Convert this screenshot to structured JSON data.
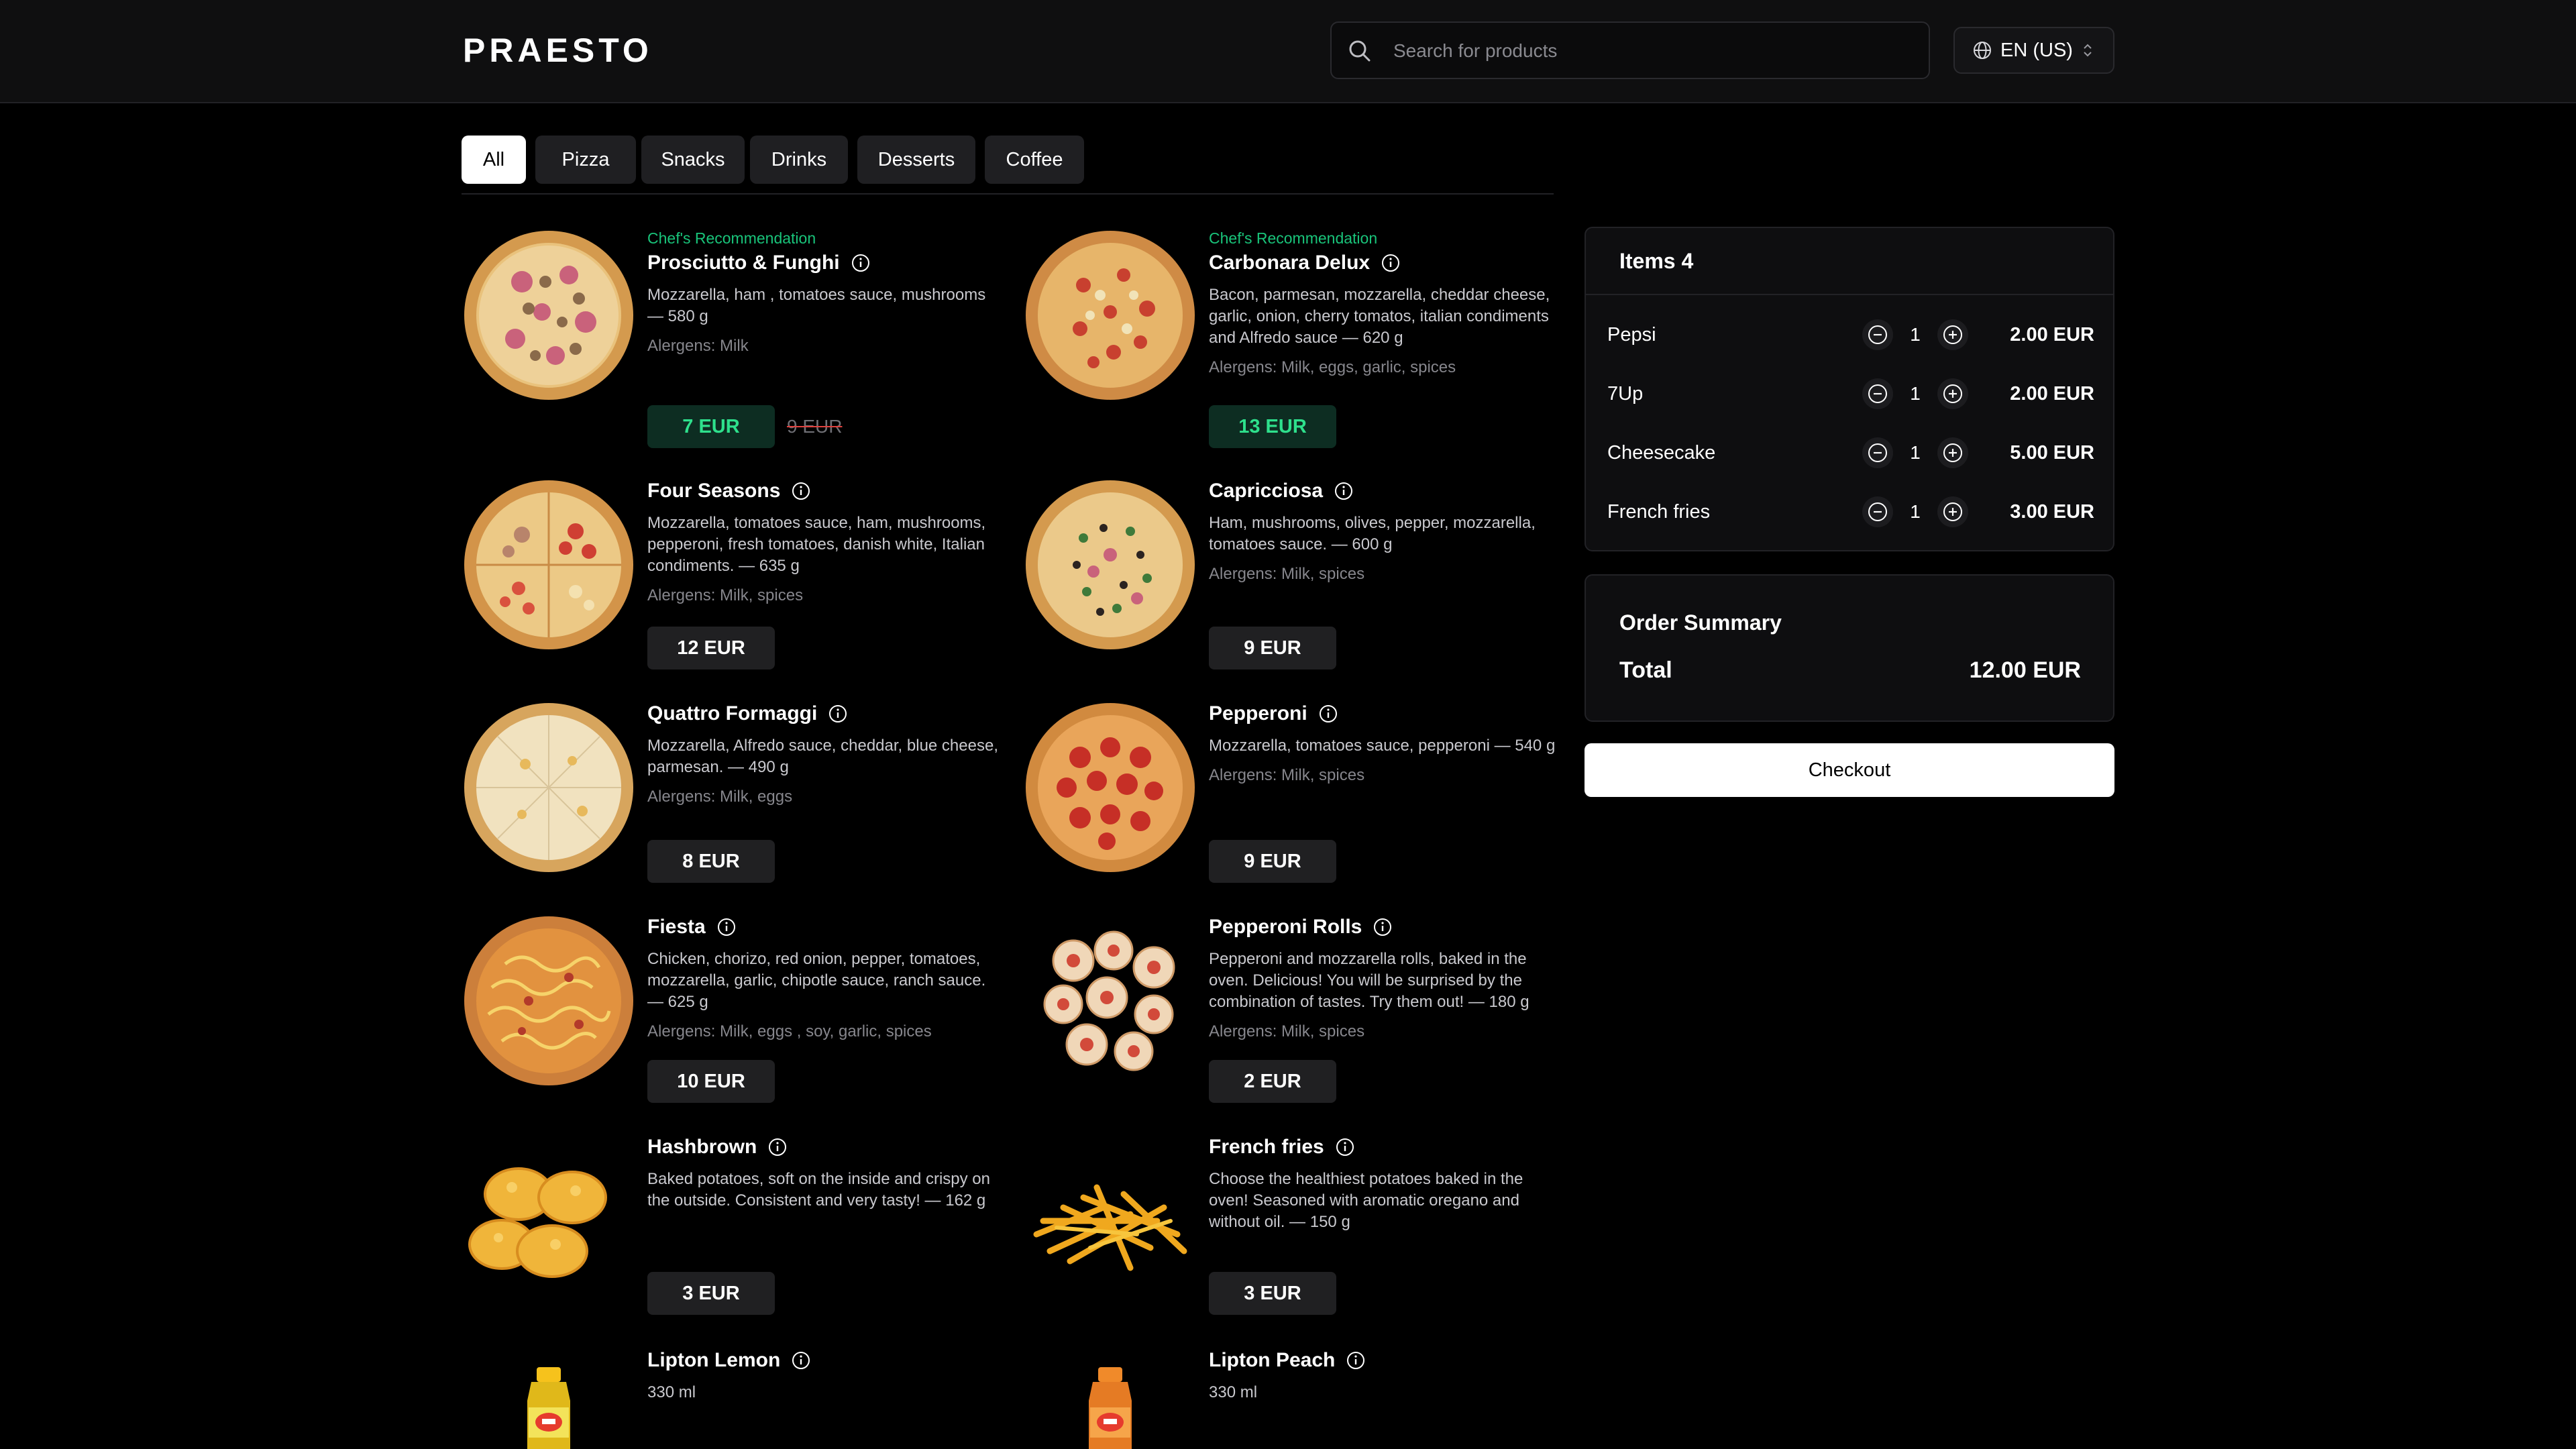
{
  "header": {
    "logo": "PRAESTO",
    "search_placeholder": "Search for products",
    "language": "EN (US)"
  },
  "tabs": [
    "All",
    "Pizza",
    "Snacks",
    "Drinks",
    "Desserts",
    "Coffee"
  ],
  "active_tab": "All",
  "products": [
    {
      "recommendation": "Chef's Recommendation",
      "name": "Prosciutto & Funghi",
      "description": "Mozzarella, ham , tomatoes sauce, mushrooms — 580 g",
      "allergens": "Alergens: Milk",
      "price": "7 EUR",
      "old_price": "9 EUR",
      "image": "pizza-prosciutto"
    },
    {
      "recommendation": "Chef's Recommendation",
      "name": "Carbonara Delux",
      "description": "Bacon, parmesan, mozzarella, cheddar cheese, garlic, onion, cherry tomatos, italian condiments and Alfredo sauce — 620 g",
      "allergens": "Alergens: Milk, eggs, garlic, spices",
      "price": "13 EUR",
      "image": "pizza-carbonara"
    },
    {
      "name": "Four Seasons",
      "description": "Mozzarella, tomatoes sauce, ham, mushrooms, pepperoni, fresh tomatoes, danish white, Italian condiments. — 635 g",
      "allergens": "Alergens: Milk, spices",
      "price": "12 EUR",
      "image": "pizza-four-seasons"
    },
    {
      "name": "Capricciosa",
      "description": "Ham, mushrooms, olives, pepper, mozzarella, tomatoes sauce. — 600 g",
      "allergens": "Alergens: Milk, spices",
      "price": "9 EUR",
      "image": "pizza-capricciosa"
    },
    {
      "name": "Quattro Formaggi",
      "description": "Mozzarella, Alfredo sauce, cheddar, blue cheese, parmesan. — 490 g",
      "allergens": "Alergens: Milk, eggs",
      "price": "8 EUR",
      "image": "pizza-quattro-formaggi"
    },
    {
      "name": "Pepperoni",
      "description": "Mozzarella, tomatoes sauce, pepperoni — 540 g",
      "allergens": "Alergens: Milk, spices",
      "price": "9 EUR",
      "image": "pizza-pepperoni"
    },
    {
      "name": "Fiesta",
      "description": "Chicken, chorizo, red onion, pepper, tomatoes, mozzarella, garlic, chipotle sauce, ranch sauce. — 625 g",
      "allergens": "Alergens: Milk, eggs , soy, garlic, spices",
      "price": "10 EUR",
      "image": "pizza-fiesta"
    },
    {
      "name": "Pepperoni Rolls",
      "description": "Pepperoni and mozzarella rolls, baked in the oven. Delicious! You will be surprised by the combination of tastes. Try them out! — 180 g",
      "allergens": "Alergens: Milk, spices",
      "price": "2 EUR",
      "image": "pepperoni-rolls"
    },
    {
      "name": "Hashbrown",
      "description": "Baked potatoes, soft on the inside and crispy on the outside. Consistent and very tasty! — 162 g",
      "price": "3 EUR",
      "image": "hashbrown"
    },
    {
      "name": "French fries",
      "description": "Choose the healthiest potatoes baked in the oven! Seasoned with aromatic oregano and without oil. — 150 g",
      "price": "3 EUR",
      "image": "french-fries"
    },
    {
      "name": "Lipton Lemon",
      "description": "330 ml",
      "image": "lipton-lemon-bottle"
    },
    {
      "name": "Lipton Peach",
      "description": "330 ml",
      "image": "lipton-peach-bottle"
    }
  ],
  "cart": {
    "title": "Items 4",
    "items": [
      {
        "name": "Pepsi",
        "qty": "1",
        "total": "2.00 EUR"
      },
      {
        "name": "7Up",
        "qty": "1",
        "total": "2.00 EUR"
      },
      {
        "name": "Cheesecake",
        "qty": "1",
        "total": "5.00 EUR"
      },
      {
        "name": "French fries",
        "qty": "1",
        "total": "3.00 EUR"
      }
    ]
  },
  "summary": {
    "title": "Order Summary",
    "total_label": "Total",
    "total_value": "12.00 EUR"
  },
  "checkout_label": "Checkout",
  "colors": {
    "background": "#000000",
    "accent_green": "#2ee08c",
    "recommendation_green": "#19c47a",
    "price_bg": "#202022"
  }
}
